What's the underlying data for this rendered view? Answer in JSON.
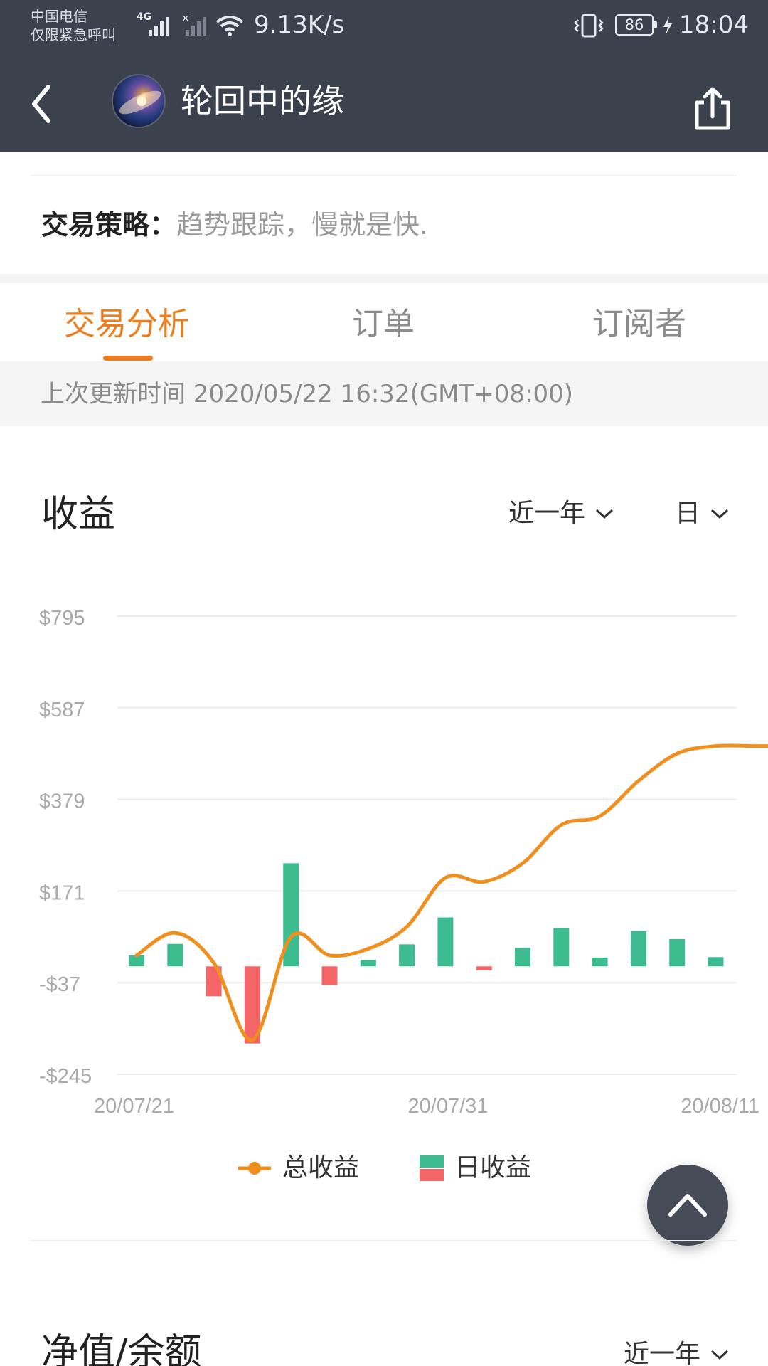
{
  "status_bar": {
    "carrier_line1": "中国电信",
    "carrier_line2": "仅限紧急呼叫",
    "network": "4G",
    "speed": "9.13K/s",
    "battery": "86",
    "time": "18:04"
  },
  "nav": {
    "title": "轮回中的缘",
    "back_icon": "chevron-left-icon",
    "share_icon": "share-icon"
  },
  "strategy": {
    "label": "交易策略：",
    "value": "趋势跟踪，慢就是快."
  },
  "tabs": [
    {
      "label": "交易分析",
      "active": true
    },
    {
      "label": "订单",
      "active": false
    },
    {
      "label": "订阅者",
      "active": false
    }
  ],
  "update": {
    "text": "上次更新时间 2020/05/22 16:32(GMT+08:00)"
  },
  "profit_section": {
    "title": "收益",
    "range_dropdown": "近一年",
    "granularity_dropdown": "日"
  },
  "chart_data": {
    "type": "bar",
    "title": "",
    "xlabel": "",
    "ylabel": "",
    "y_ticks": [
      "$795",
      "$587",
      "$379",
      "$171",
      "-$37",
      "-$245"
    ],
    "y_tick_values": [
      795,
      587,
      379,
      171,
      -37,
      -245
    ],
    "ylim": [
      -245,
      795
    ],
    "x_tick_labels": [
      "20/07/21",
      "20/07/31",
      "20/08/11"
    ],
    "categories": [
      "1",
      "2",
      "3",
      "4",
      "5",
      "6",
      "7",
      "8",
      "9",
      "10",
      "11",
      "12",
      "13",
      "14",
      "15",
      "16",
      "17",
      "18"
    ],
    "series": [
      {
        "name": "日收益",
        "kind": "bar",
        "positive_color": "#3dbd8f",
        "negative_color": "#f46567",
        "values": [
          25,
          51,
          -68,
          -175,
          234,
          -42,
          15,
          50,
          111,
          -9,
          42,
          87,
          20,
          80,
          62,
          21,
          0,
          0
        ]
      },
      {
        "name": "总收益",
        "kind": "line",
        "color": "#f08f1e",
        "values": [
          25,
          76,
          8,
          -167,
          67,
          25,
          40,
          90,
          201,
          192,
          234,
          321,
          341,
          421,
          483,
          500,
          500,
          500
        ]
      }
    ],
    "grid": true,
    "legend_position": "bottom"
  },
  "legend": {
    "line_label": "总收益",
    "bar_label": "日收益"
  },
  "net_section": {
    "title": "净值/余额",
    "range_dropdown": "近一年"
  },
  "colors": {
    "header_bg": "#3b424e",
    "accent": "#f07d1b",
    "positive": "#3dbd8f",
    "negative": "#f46567",
    "line": "#f08f1e"
  }
}
